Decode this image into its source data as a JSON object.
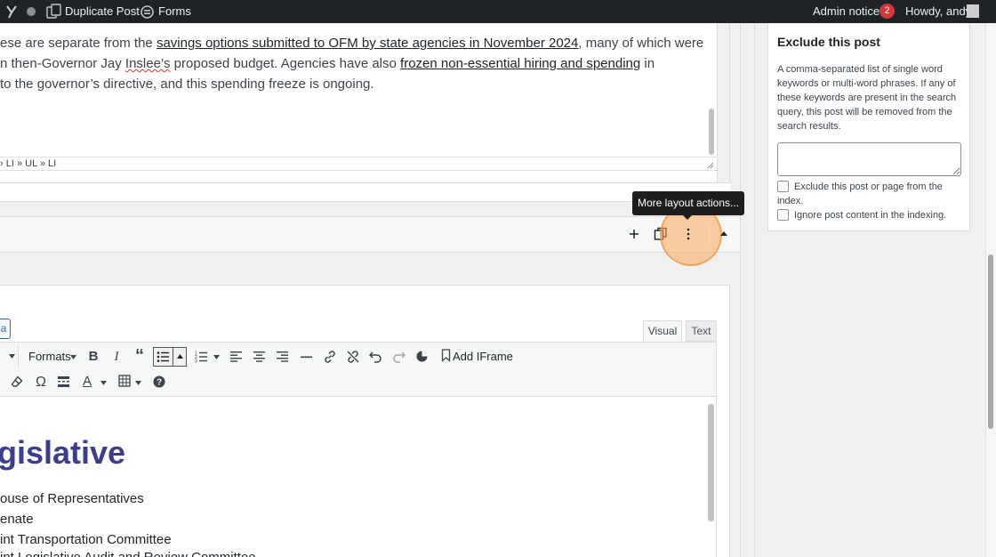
{
  "admin_bar": {
    "duplicate_post": "Duplicate Post",
    "forms": "Forms",
    "admin_notices": "Admin notices",
    "notices_count": "2",
    "greeting": "Howdy, andy"
  },
  "top_editor": {
    "line1_pre": "ese are separate from the ",
    "line1_link": "savings options submitted to OFM by state agencies in November 2024",
    "line1_post": ", many of which were",
    "line2_pre": "n then-Governor Jay ",
    "line2_spell": "Inslee’s",
    "line2_mid": " proposed budget. Agencies have also ",
    "line2_link": "frozen non-essential hiring and spending",
    "line2_post": " in",
    "line3": " to the governor’s directive, and this spending freeze is ongoing.",
    "path": "› LI » UL » LI"
  },
  "layout_toolbar": {
    "tooltip": "More layout actions..."
  },
  "editor": {
    "partial_button": "a",
    "tab_visual": "Visual",
    "tab_text": "Text",
    "formats": "Formats",
    "add_iframe": "Add IFrame",
    "heading": "gislative",
    "items": [
      "ouse of Representatives",
      "enate",
      "int Transportation Committee",
      "int Legislative Audit and Review Committee"
    ]
  },
  "sidebar": {
    "title": "Exclude this post",
    "description_lines": [
      "A comma-separated list of single word",
      "keywords or multi-word phrases. If any of",
      "these keywords are present in the search",
      "query, this post will be removed from the",
      "search results."
    ],
    "exclude_line1": "Exclude this post or page from the",
    "exclude_line2": "index.",
    "ignore_content": "Ignore post content in the indexing.",
    "keywords_value": ""
  }
}
